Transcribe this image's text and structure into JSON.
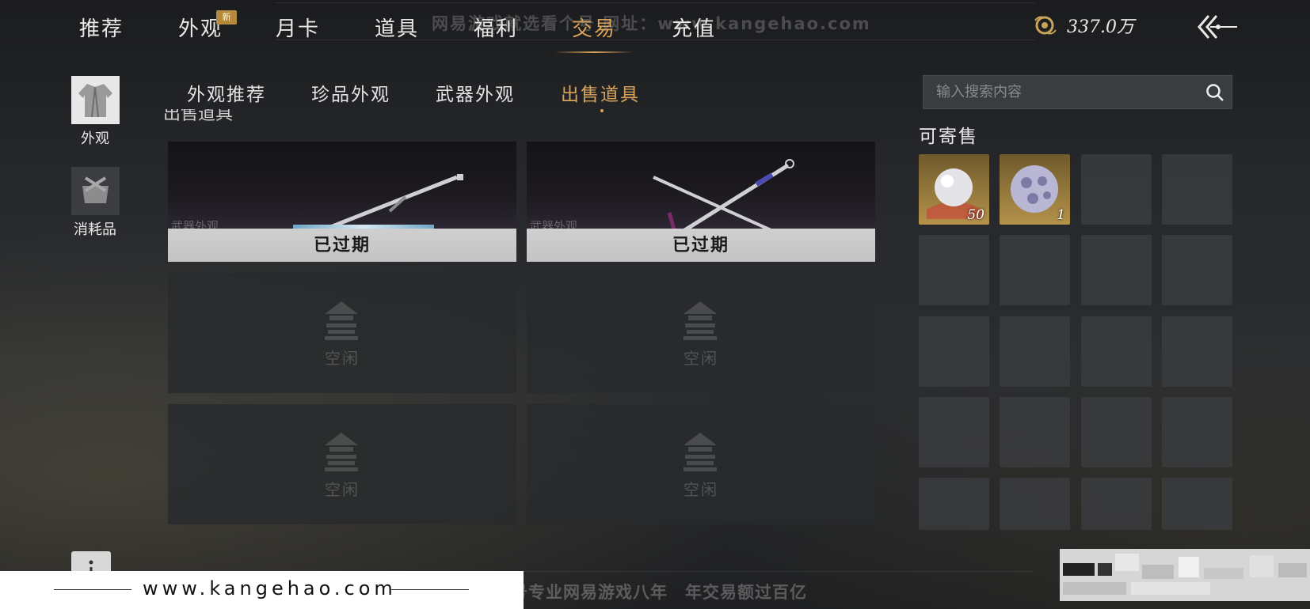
{
  "top_nav": {
    "tabs": [
      "推荐",
      "外观",
      "月卡",
      "道具",
      "福利",
      "交易",
      "充值"
    ],
    "active_tab": "交易",
    "new_badge": "新",
    "watermark": "网易游戏就选看个号 网址：www.kangehao.com",
    "currency_amount": "337.0万"
  },
  "sidebar": {
    "items": [
      {
        "label": "外观",
        "active": true
      },
      {
        "label": "消耗品",
        "active": false
      }
    ]
  },
  "sub_tabs": {
    "items": [
      "外观推荐",
      "珍品外观",
      "武器外观",
      "出售道具"
    ],
    "active": "出售道具"
  },
  "section_title": "出售道具",
  "listings": [
    {
      "status": "已过期",
      "category": "武器外观"
    },
    {
      "status": "已过期",
      "category": "武器外观"
    },
    {
      "status": "空闲"
    },
    {
      "status": "空闲"
    },
    {
      "status": "空闲"
    },
    {
      "status": "空闲"
    }
  ],
  "right_panel": {
    "search_placeholder": "输入搜索内容",
    "title": "可寄售",
    "items": [
      {
        "name": "pearl",
        "qty": "50"
      },
      {
        "name": "jade-orb",
        "qty": "1"
      }
    ]
  },
  "footer": {
    "site": "www.kangehao.com",
    "slogan": "看个号专业网易游戏八年　年交易额过百亿"
  },
  "colors": {
    "accent": "#d9a35a",
    "gold_slot": "#b4924a"
  }
}
